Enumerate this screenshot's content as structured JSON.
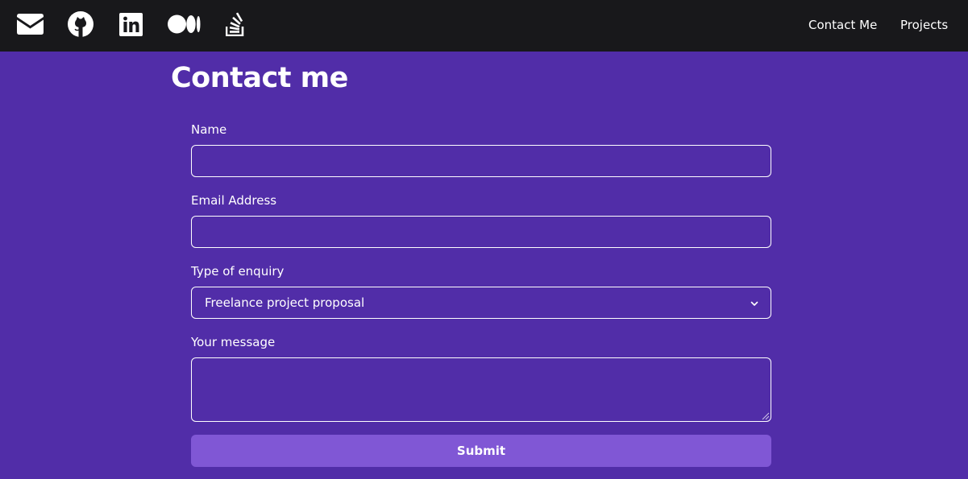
{
  "navbar": {
    "icons": [
      {
        "name": "mail-icon"
      },
      {
        "name": "github-icon"
      },
      {
        "name": "linkedin-icon"
      },
      {
        "name": "medium-icon"
      },
      {
        "name": "stackoverflow-icon"
      }
    ],
    "links": [
      {
        "label": "Contact Me"
      },
      {
        "label": "Projects"
      }
    ]
  },
  "main": {
    "title": "Contact me",
    "form": {
      "name_label": "Name",
      "name_value": "",
      "email_label": "Email Address",
      "email_value": "",
      "enquiry_label": "Type of enquiry",
      "enquiry_selected": "Freelance project proposal",
      "message_label": "Your message",
      "message_value": "",
      "submit_label": "Submit"
    }
  },
  "colors": {
    "page_background": "#512DA8",
    "navbar_background": "#18181B",
    "submit_background": "#8057D5",
    "text": "#FFFFFF"
  }
}
